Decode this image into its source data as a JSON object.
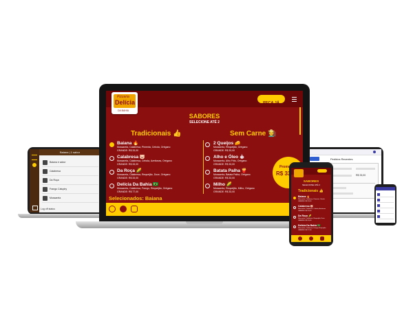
{
  "brand": {
    "line1": "Pizzaria",
    "line2": "Delícia",
    "line3": "DA BAHIA"
  },
  "header": {
    "order_button": "PEÇA JÁ"
  },
  "menu": {
    "title": "SABORES",
    "subtitle": "SELECIONE ATÉ 2",
    "col1_title": "Tradicionais 👍",
    "col2_title": "Sem Carne 🧑‍🌾",
    "col1": [
      {
        "name": "Baiana 🔥",
        "desc": "Mossarela, Calabresa, Pimenta, Cebola, Orégano",
        "price": "GRANDE: R$ 33,00"
      },
      {
        "name": "Calabresa 🐷",
        "desc": "Mossarela, Calabresa, Cebola, Azeitonas, Orégano",
        "price": "GRANDE: R$ 33,00"
      },
      {
        "name": "Da Roça 🌽",
        "desc": "Mossarela, Calabresa, Requeijão, Doce, Orégano",
        "price": "GRANDE: R$ 33,00"
      },
      {
        "name": "Delícia Da Bahia 🇧🇷",
        "desc": "Mossarela, Calabresa, Frango, Requeijão, Orégano",
        "price": "GRANDE: R$ 77,00"
      }
    ],
    "col2": [
      {
        "name": "2 Queijos 🧀",
        "desc": "Mossarela, Requeijão, Orégano",
        "price": "GRANDE: R$ 33,00"
      },
      {
        "name": "Alho e Óleo 🧄",
        "desc": "Mossarela, Alho Frito, Orégano",
        "price": "GRANDE: R$ 33,00"
      },
      {
        "name": "Batata Palha 🍟",
        "desc": "Mossarela, Batata Palha, Orégano",
        "price": "GRANDE: R$ 33,00"
      },
      {
        "name": "Milho 🌽",
        "desc": "Mossarela, Requeijão, Milho, Orégano",
        "price": "GRANDE: R$ 33,00"
      }
    ],
    "selected": "Selecionados: Baiana",
    "promo_label": "Promo",
    "promo_price": "R$ 33,..."
  },
  "left_tablet": {
    "title": "Baiana | 1 sabor",
    "items": [
      "Baiana e sabor",
      "Calabresa",
      "Da Roça",
      "Frango Catupiry",
      "Mussarela"
    ],
    "footer": "Log off status"
  },
  "right_tablet": {
    "title": "Pedidos Recentes",
    "total": "R$ 33,00"
  },
  "phone": {
    "title": "SABORES",
    "subtitle": "SELECIONE ATÉ 2",
    "section": "Tradicionais 👍",
    "items": [
      {
        "name": "Baiana 🔥",
        "desc": "Mossarela, Calabresa, Pimenta, Cebola",
        "price": "GRANDE: R$ 33,00"
      },
      {
        "name": "Calabresa 🐷",
        "desc": "Mossarela, Calabresa, Cebola, Azeitonas",
        "price": "GRANDE: R$ 33,00"
      },
      {
        "name": "Da Roça 🌽",
        "desc": "Mossarela, Calabresa, Requeijão, Doce",
        "price": "GRANDE: R$ 33,00"
      },
      {
        "name": "Delícia Da Bahia 🇧🇷",
        "desc": "Mossarela, Calabresa, Frango, Requeijão",
        "price": "GRANDE: R$ 77,00"
      }
    ]
  },
  "colors": {
    "primary": "#8b0f0f",
    "accent": "#ffcc00"
  }
}
